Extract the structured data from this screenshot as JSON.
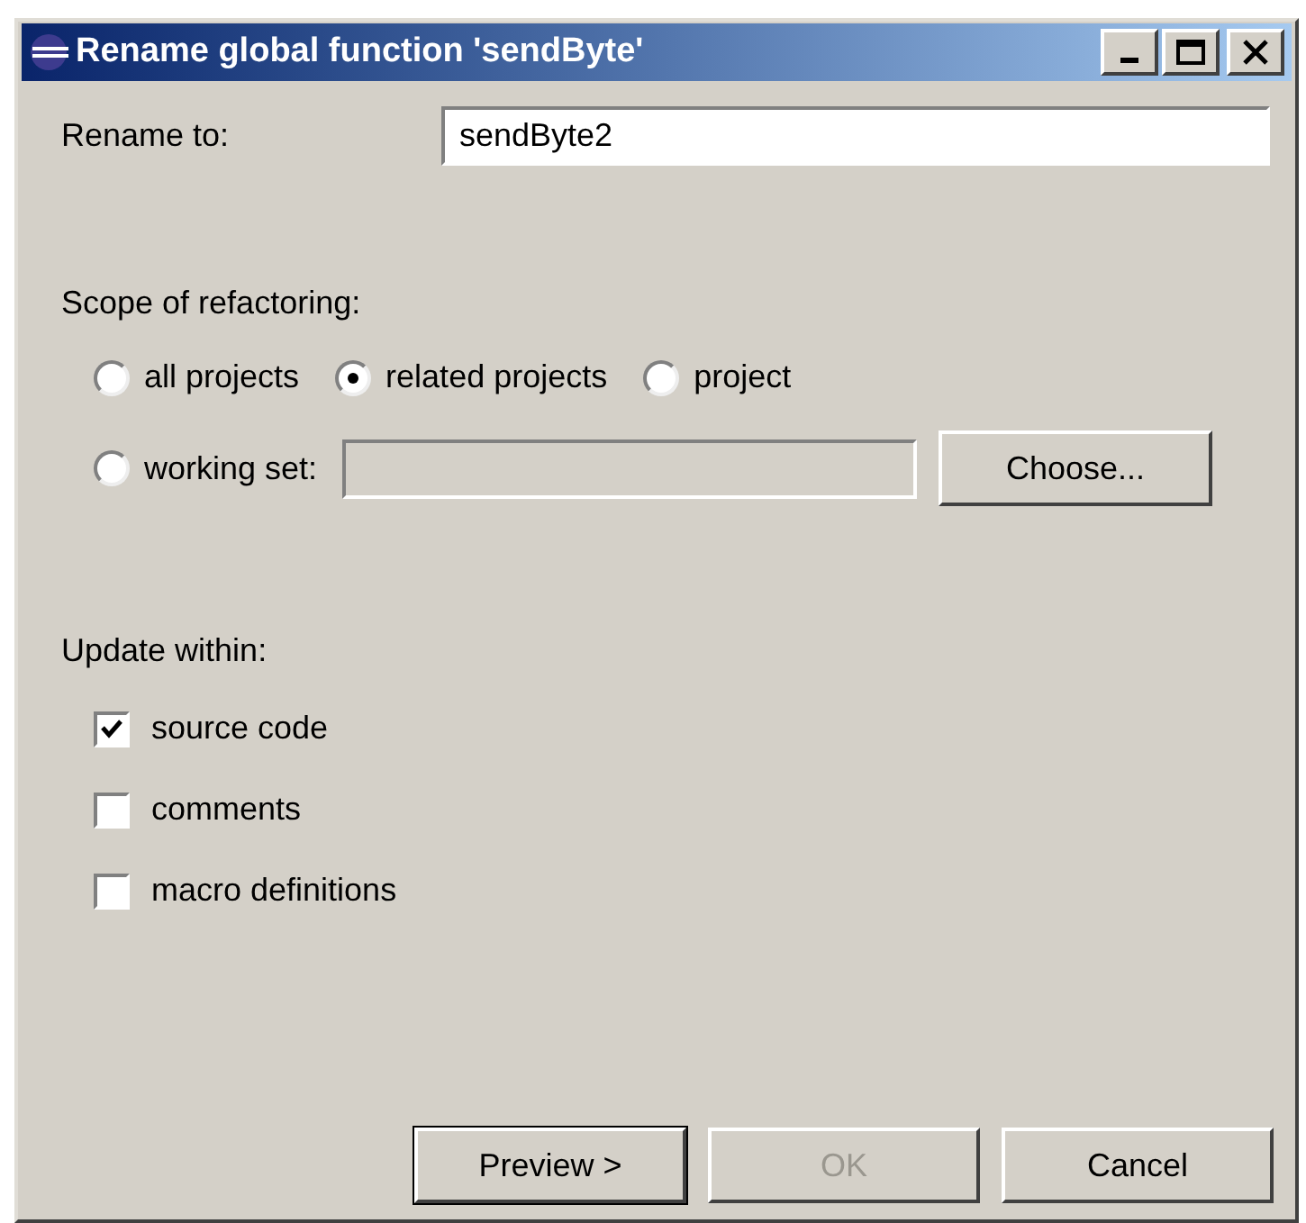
{
  "window": {
    "title": "Rename global function 'sendByte'"
  },
  "rename": {
    "label": "Rename to:",
    "value": "sendByte2"
  },
  "scope": {
    "label": "Scope of refactoring:",
    "options": [
      {
        "label": "all projects",
        "selected": false
      },
      {
        "label": "related projects",
        "selected": true
      },
      {
        "label": "project",
        "selected": false
      },
      {
        "label": "working set:",
        "selected": false
      }
    ],
    "working_set_field": {
      "disabled": true
    },
    "choose_button": "Choose..."
  },
  "update": {
    "label": "Update within:",
    "items": [
      {
        "label": "source code",
        "checked": true
      },
      {
        "label": "comments",
        "checked": false
      },
      {
        "label": "macro definitions",
        "checked": false
      }
    ]
  },
  "buttons": [
    {
      "label": "Preview >",
      "disabled": false,
      "default": true
    },
    {
      "label": "OK",
      "disabled": true,
      "default": false
    },
    {
      "label": "Cancel",
      "disabled": false,
      "default": false
    }
  ]
}
